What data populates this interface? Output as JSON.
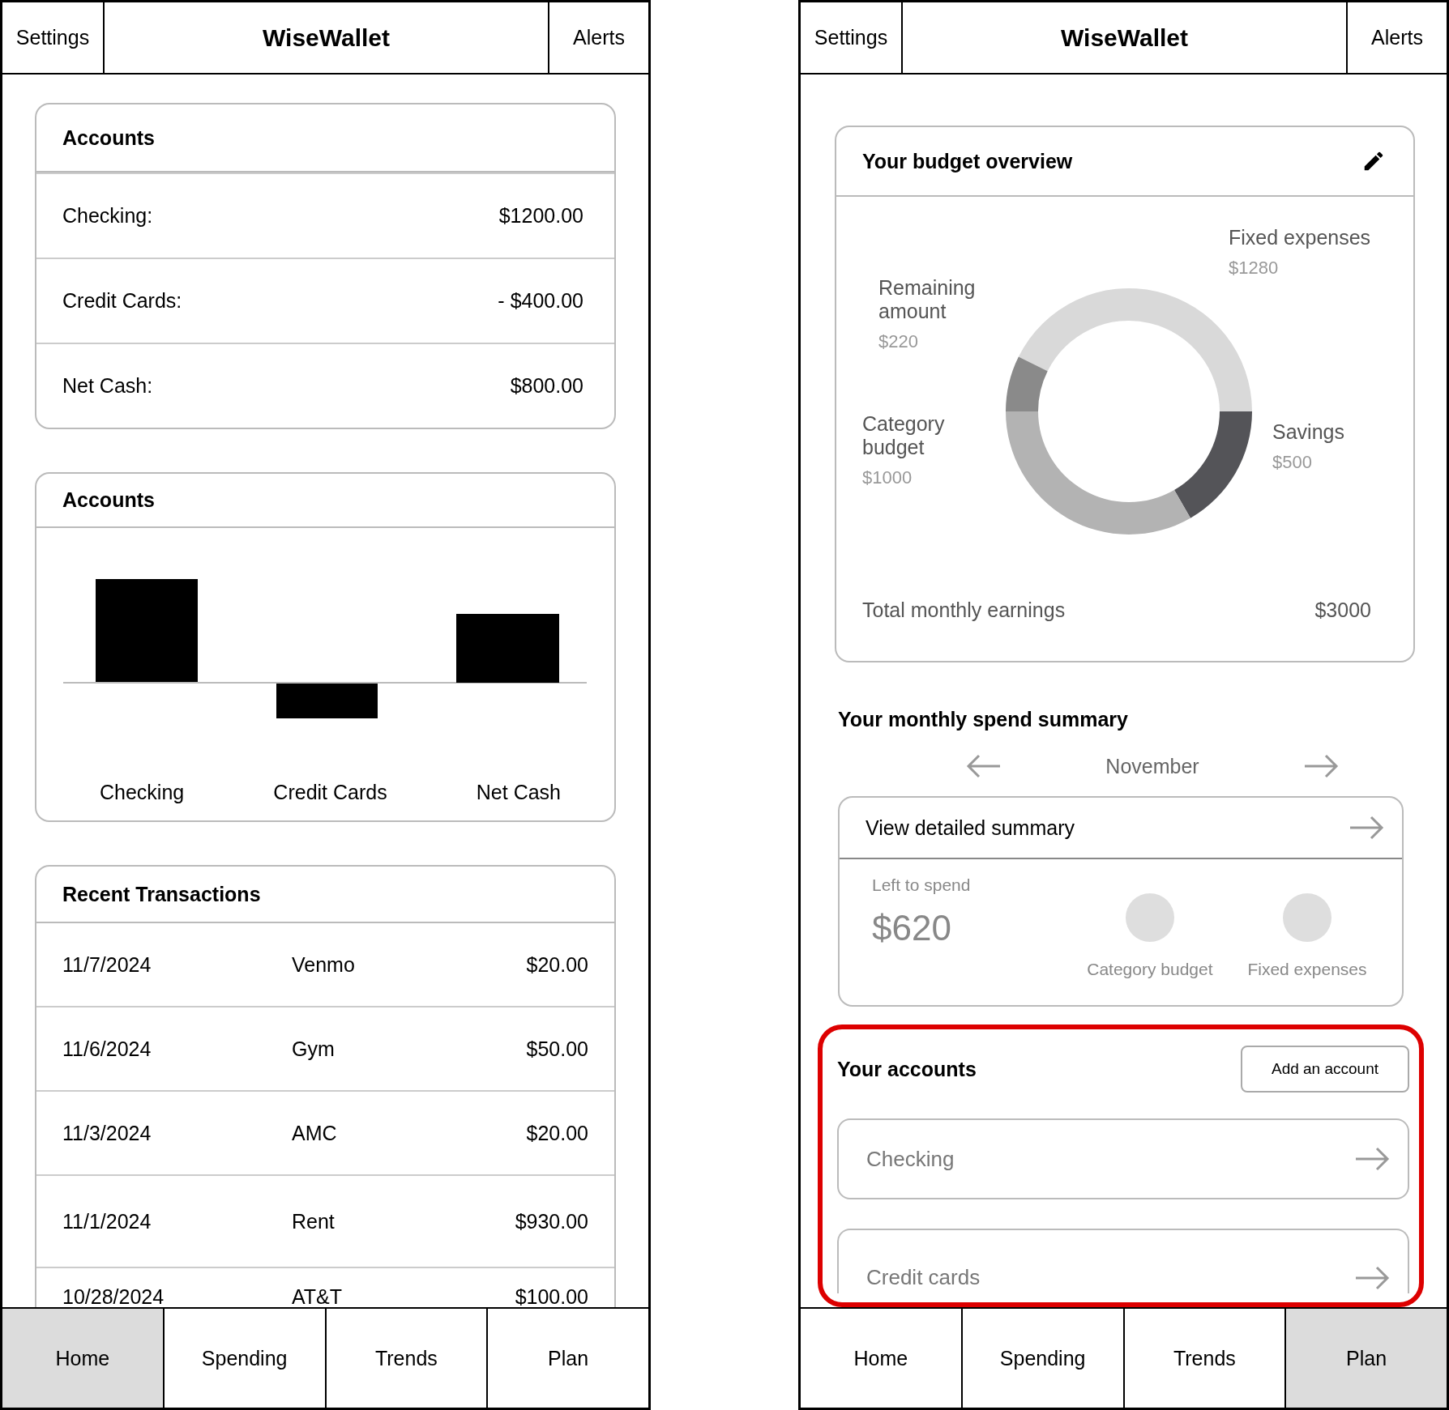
{
  "screens": [
    {
      "kind": "home",
      "header": {
        "left": "Settings",
        "title": "WiseWallet",
        "right": "Alerts"
      },
      "accounts": {
        "title": "Accounts",
        "rows": [
          {
            "label": "Checking:",
            "amount": "$1200.00"
          },
          {
            "label": "Credit Cards:",
            "amount": "- $400.00"
          },
          {
            "label": "Net Cash:",
            "amount": "$800.00"
          }
        ]
      },
      "account_chart": {
        "title": "Accounts",
        "labels": [
          "Checking",
          "Credit Cards",
          "Net Cash"
        ]
      },
      "transactions": {
        "title": "Recent Transactions",
        "rows": [
          {
            "date": "11/7/2024",
            "payee": "Venmo",
            "amount": "$20.00"
          },
          {
            "date": "11/6/2024",
            "payee": "Gym",
            "amount": "$50.00"
          },
          {
            "date": "11/3/2024",
            "payee": "AMC",
            "amount": "$20.00"
          },
          {
            "date": "11/1/2024",
            "payee": "Rent",
            "amount": "$930.00"
          },
          {
            "date": "10/28/2024",
            "payee": "AT&T",
            "amount": "$100.00"
          }
        ]
      },
      "tabs": [
        {
          "label": "Home",
          "selected": true
        },
        {
          "label": "Spending",
          "selected": false
        },
        {
          "label": "Trends",
          "selected": false
        },
        {
          "label": "Plan",
          "selected": false
        }
      ]
    },
    {
      "kind": "plan",
      "header": {
        "left": "Settings",
        "title": "WiseWallet",
        "right": "Alerts"
      },
      "budget": {
        "title": "Your budget overview",
        "chart_data": {
          "type": "donut",
          "categories": [
            "Fixed expenses",
            "Savings",
            "Category budget",
            "Remaining amount"
          ],
          "values": [
            1280,
            500,
            1000,
            220
          ],
          "value_labels": [
            "$1280",
            "$500",
            "$1000",
            "$220"
          ]
        },
        "total_label": "Total monthly earnings",
        "total": "$3000"
      },
      "spend": {
        "title": "Your monthly spend summary",
        "month": "November",
        "detail_link": "View detailed summary",
        "left_label": "Left to spend",
        "left_amount": "$620",
        "indicators": [
          "Category budget",
          "Fixed expenses"
        ]
      },
      "accounts": {
        "title": "Your accounts",
        "highlighted": true,
        "add_button": "Add an account",
        "items": [
          "Checking",
          "Credit cards"
        ]
      },
      "tabs": [
        {
          "label": "Home",
          "selected": false
        },
        {
          "label": "Spending",
          "selected": false
        },
        {
          "label": "Trends",
          "selected": false
        },
        {
          "label": "Plan",
          "selected": true
        }
      ]
    }
  ]
}
